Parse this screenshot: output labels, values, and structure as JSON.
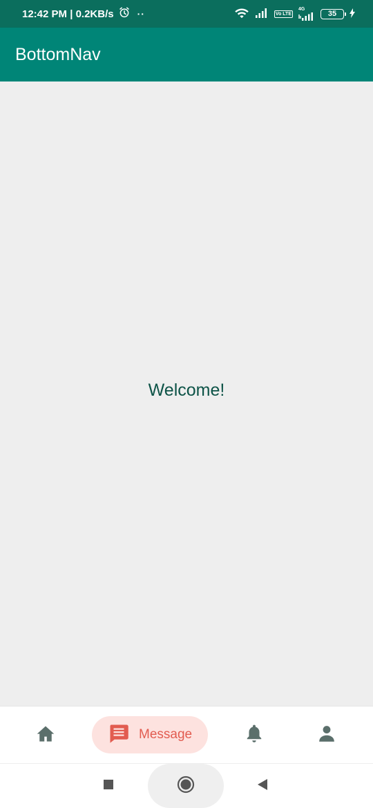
{
  "status_bar": {
    "time_speed": "12:42 PM | 0.2KB/s",
    "dots": "··",
    "volte_label": "Vo LTE",
    "network_label": "4G",
    "battery_level": "35"
  },
  "app_bar": {
    "title": "BottomNav"
  },
  "content": {
    "welcome_text": "Welcome!"
  },
  "bottom_nav": {
    "selected_index": 1,
    "items": [
      {
        "icon": "home-icon",
        "label": ""
      },
      {
        "icon": "message-icon",
        "label": "Message"
      },
      {
        "icon": "bell-icon",
        "label": ""
      },
      {
        "icon": "person-icon",
        "label": ""
      }
    ],
    "icon_color": "#5b6f6b",
    "selected_color": "#e25c50",
    "selected_bg": "#fde2df"
  },
  "colors": {
    "status_bar": "#0b6e5d",
    "app_bar": "#008577",
    "background": "#eeeeee",
    "welcome_text": "#0d5347"
  }
}
